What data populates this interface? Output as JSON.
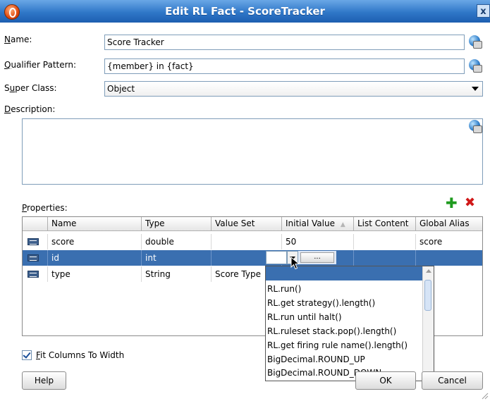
{
  "window": {
    "title": "Edit RL Fact - ScoreTracker",
    "close_glyph": "x"
  },
  "form": {
    "name_label": "Name:",
    "name_mnemonic": "N",
    "name_value": "Score Tracker",
    "qualifier_label": "Qualifier Pattern:",
    "qualifier_mnemonic": "Q",
    "qualifier_value": "{member} in {fact}",
    "superclass_label": "Super Class:",
    "superclass_value": "Object",
    "description_label": "Description:",
    "description_mnemonic": "D",
    "description_value": ""
  },
  "properties": {
    "label": "Properties:",
    "label_mnemonic": "P",
    "add_icon": "plus-icon",
    "delete_icon": "x-icon",
    "columns": [
      "Name",
      "Type",
      "Value Set",
      "Initial Value",
      "List Content",
      "Global Alias"
    ],
    "sort_indicator": "▲",
    "rows": [
      {
        "name": "score",
        "type": "double",
        "value_set": "",
        "initial_value": "50",
        "list_content": "",
        "global_alias": "score",
        "selected": false
      },
      {
        "name": "id",
        "type": "int",
        "value_set": "",
        "initial_value": "",
        "list_content": "",
        "global_alias": "",
        "selected": true
      },
      {
        "name": "type",
        "type": "String",
        "value_set": "Score Type",
        "initial_value": "",
        "list_content": "",
        "global_alias": "",
        "selected": false
      }
    ],
    "editor": {
      "dots_label": "..."
    },
    "dropdown_options": [
      "RL.run()",
      "RL.get strategy().length()",
      "RL.run until halt()",
      "RL.ruleset stack.pop().length()",
      "RL.get firing rule name().length()",
      "BigDecimal.ROUND_UP",
      "BigDecimal.ROUND_DOWN"
    ]
  },
  "options": {
    "fit_columns_label": "Fit Columns To Width",
    "fit_columns_checked": true
  },
  "buttons": {
    "help": "Help",
    "ok": "OK",
    "cancel": "Cancel"
  },
  "colors": {
    "titlebar": "#2f77c8",
    "selection": "#3a6fb0",
    "add": "#1e9a1e",
    "delete": "#d01818"
  }
}
